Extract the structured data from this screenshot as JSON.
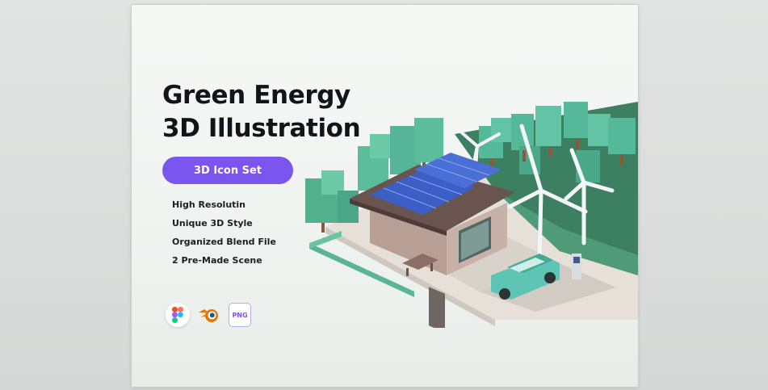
{
  "title_lines": [
    "Green Energy",
    "3D Illustration"
  ],
  "badge_label": "3D Icon Set",
  "features": [
    "High Resolutin",
    "Unique 3D Style",
    "Organized Blend File",
    "2 Pre-Made Scene"
  ],
  "tools": [
    {
      "icon": "figma-icon"
    },
    {
      "icon": "blender-icon"
    },
    {
      "icon": "png-file-icon",
      "label": "PNG"
    }
  ],
  "colors": {
    "accent": "#7a55ee",
    "tree": "#4fb597",
    "solar_panel": "#3f63c9",
    "car": "#5ec4b3",
    "background": "#f6f8f6"
  }
}
